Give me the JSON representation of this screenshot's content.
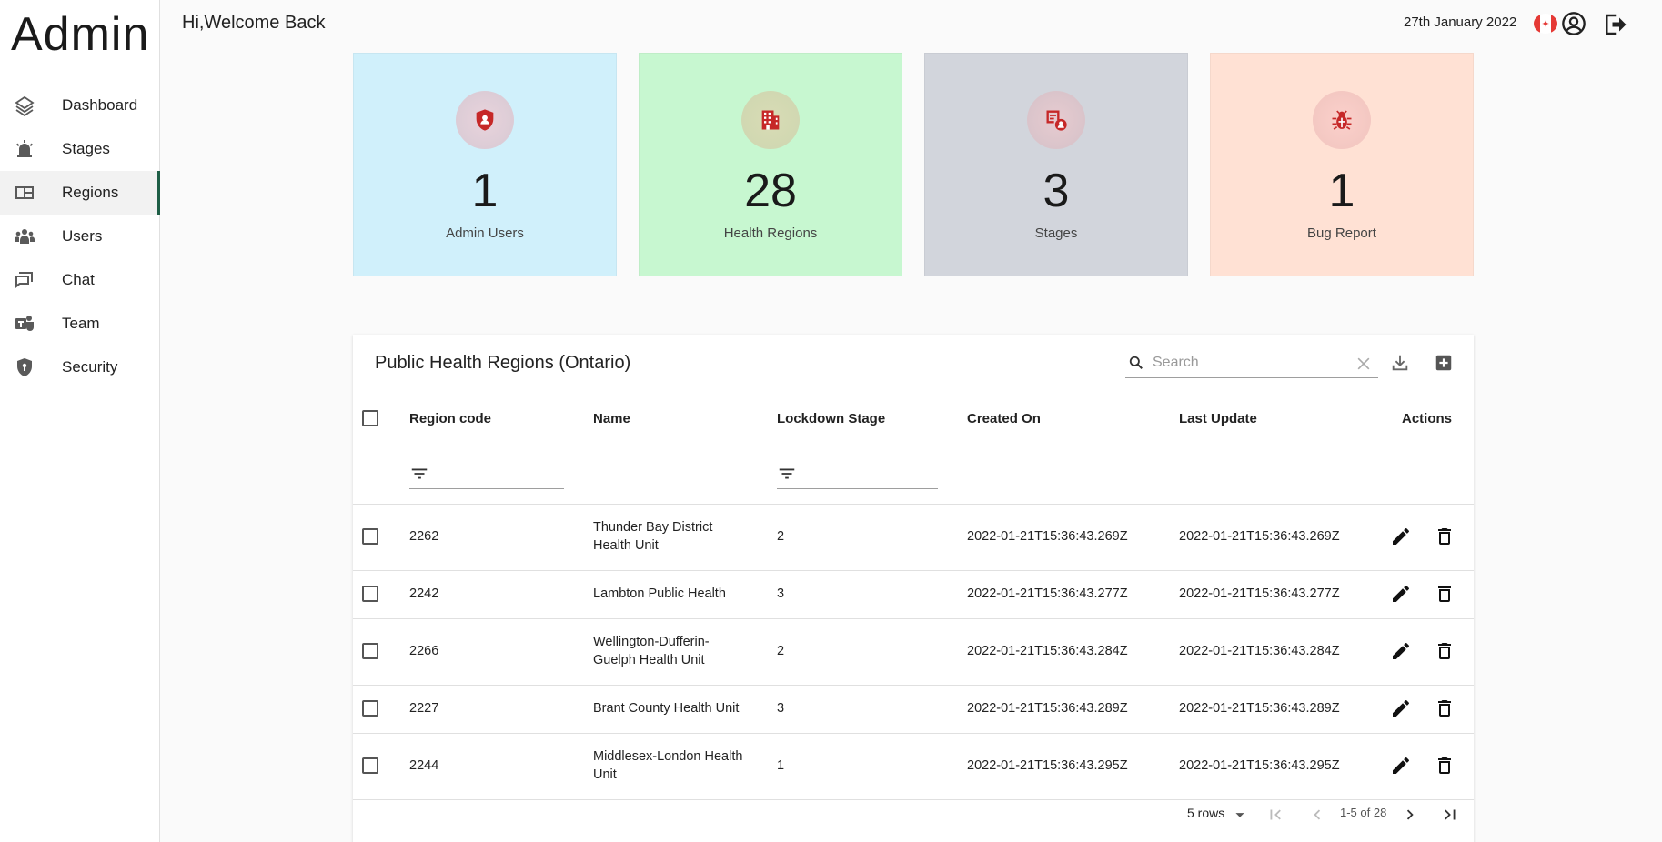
{
  "brand": "Admin",
  "sidebar": {
    "items": [
      {
        "label": "Dashboard",
        "icon": "dashboard-icon"
      },
      {
        "label": "Stages",
        "icon": "stages-icon"
      },
      {
        "label": "Regions",
        "icon": "regions-icon",
        "active": true
      },
      {
        "label": "Users",
        "icon": "users-icon"
      },
      {
        "label": "Chat",
        "icon": "chat-icon"
      },
      {
        "label": "Team",
        "icon": "team-icon"
      },
      {
        "label": "Security",
        "icon": "security-icon"
      }
    ]
  },
  "header": {
    "greeting": "Hi,Welcome Back",
    "date": "27th January 2022"
  },
  "stats": [
    {
      "value": "1",
      "label": "Admin Users",
      "bg": "#d0f0fb",
      "icon": "admin-shield-icon"
    },
    {
      "value": "28",
      "label": "Health Regions",
      "bg": "#c7f7d0",
      "icon": "building-icon"
    },
    {
      "value": "3",
      "label": "Stages",
      "bg": "#d2d5dc",
      "icon": "stages-badge-icon"
    },
    {
      "value": "1",
      "label": "Bug Report",
      "bg": "#ffe1d4",
      "icon": "bug-icon"
    }
  ],
  "table": {
    "title": "Public Health Regions (Ontario)",
    "search_placeholder": "Search",
    "columns": [
      "Region code",
      "Name",
      "Lockdown Stage",
      "Created On",
      "Last Update",
      "Actions"
    ],
    "rows": [
      {
        "code": "2262",
        "name": "Thunder Bay District Health Unit",
        "stage": "2",
        "created": "2022-01-21T15:36:43.269Z",
        "updated": "2022-01-21T15:36:43.269Z"
      },
      {
        "code": "2242",
        "name": "Lambton Public Health",
        "stage": "3",
        "created": "2022-01-21T15:36:43.277Z",
        "updated": "2022-01-21T15:36:43.277Z"
      },
      {
        "code": "2266",
        "name": "Wellington-Dufferin-Guelph Health Unit",
        "stage": "2",
        "created": "2022-01-21T15:36:43.284Z",
        "updated": "2022-01-21T15:36:43.284Z"
      },
      {
        "code": "2227",
        "name": "Brant County Health Unit",
        "stage": "3",
        "created": "2022-01-21T15:36:43.289Z",
        "updated": "2022-01-21T15:36:43.289Z"
      },
      {
        "code": "2244",
        "name": "Middlesex-London Health Unit",
        "stage": "1",
        "created": "2022-01-21T15:36:43.295Z",
        "updated": "2022-01-21T15:36:43.295Z"
      }
    ],
    "pagination": {
      "rows_per_page": "5 rows",
      "range": "1-5 of 28"
    }
  },
  "colors": {
    "accent": "#1e5e46",
    "icon_red": "#c62828"
  }
}
